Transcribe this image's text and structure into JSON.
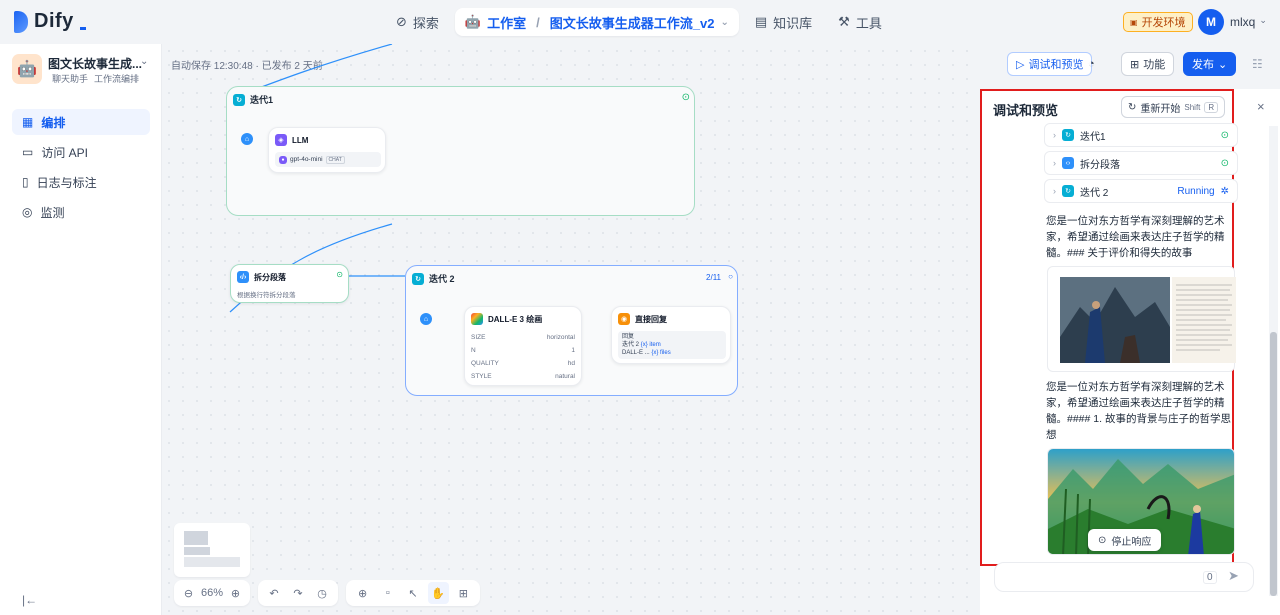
{
  "brand": {
    "name": "Dify"
  },
  "nav": {
    "explore": "探索",
    "studio": "工作室",
    "app_title": "图文长故事生成器工作流_v2",
    "knowledge": "知识库",
    "tools": "工具"
  },
  "env_badge": "开发环境",
  "user": {
    "initial": "M",
    "name": "mlxq"
  },
  "app": {
    "name": "图文长故事生成...",
    "type": "聊天助手",
    "mode": "工作流编排"
  },
  "menu": [
    {
      "label": "编排"
    },
    {
      "label": "访问 API"
    },
    {
      "label": "日志与标注"
    },
    {
      "label": "监测"
    }
  ],
  "autosave": "自动保存 12:30:48 · 已发布 2 天前",
  "header_actions": {
    "debug": "调试和预览",
    "features": "功能",
    "publish": "发布"
  },
  "nodes": {
    "iter1": {
      "title": "迭代1"
    },
    "llm": {
      "title": "LLM",
      "model": "gpt-4o-mini",
      "tag": "CHAT"
    },
    "split": {
      "title": "拆分段落",
      "desc": "根据换行符拆分段落"
    },
    "iter2": {
      "title": "迭代 2",
      "progress": "2/11"
    },
    "dalle": {
      "title": "DALL-E 3 绘画",
      "rows": [
        {
          "k": "SIZE",
          "v": "horizontal"
        },
        {
          "k": "N",
          "v": "1"
        },
        {
          "k": "QUALITY",
          "v": "hd"
        },
        {
          "k": "STYLE",
          "v": "natural"
        }
      ]
    },
    "answer": {
      "title": "直接回复",
      "label": "回复",
      "vars": [
        {
          "src": "迭代 2",
          "var": "{x} item"
        },
        {
          "src": "DALL-E ...",
          "var": "{x} files"
        }
      ]
    }
  },
  "zoom": "66%",
  "panel": {
    "title": "调试和预览",
    "restart": "重新开始",
    "shortcut1": "Shift",
    "shortcut2": "R",
    "steps": [
      {
        "name": "迭代1",
        "status": ""
      },
      {
        "name": "拆分段落",
        "status": ""
      },
      {
        "name": "迭代 2",
        "status": "Running"
      }
    ],
    "para1": "您是一位对东方哲学有深刻理解的艺术家，希望通过绘画来表达庄子哲学的精髓。### 关于评价和得失的故事",
    "para2": "您是一位对东方哲学有深刻理解的艺术家，希望通过绘画来表达庄子哲学的精髓。#### 1. 故事的背景与庄子的哲学思想",
    "stop": "停止响应",
    "counter": "0"
  },
  "colors": {
    "accent": "#155eef",
    "highlight": "#e11d1d",
    "success": "#12b76a"
  }
}
